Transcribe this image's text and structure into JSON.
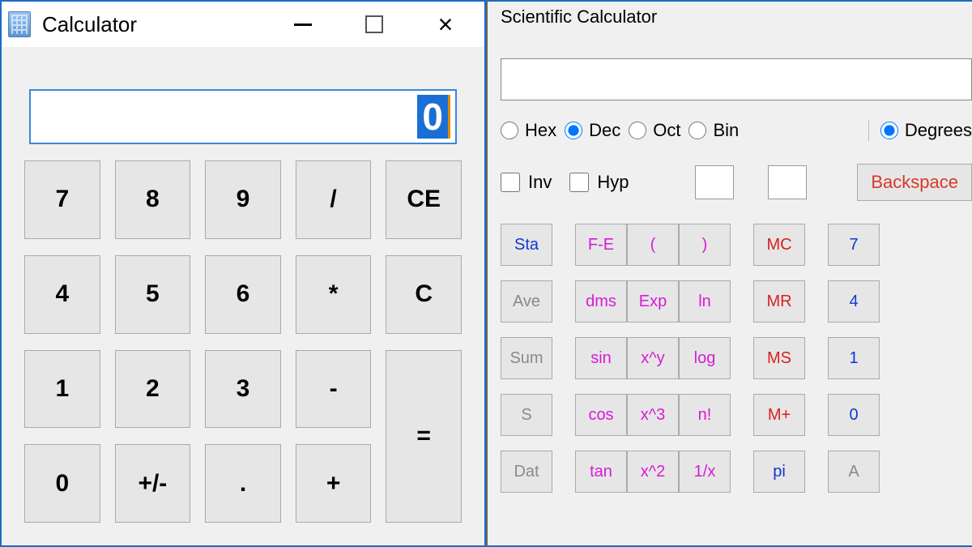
{
  "simple": {
    "title": "Calculator",
    "display": "0",
    "keys": [
      "7",
      "8",
      "9",
      "/",
      "CE",
      "4",
      "5",
      "6",
      "*",
      "C",
      "1",
      "2",
      "3",
      "-",
      "=",
      "0",
      "+/-",
      ".",
      "+"
    ]
  },
  "sci": {
    "title": "Scientific Calculator",
    "display": "",
    "bases": [
      {
        "label": "Hex",
        "checked": false
      },
      {
        "label": "Dec",
        "checked": true
      },
      {
        "label": "Oct",
        "checked": false
      },
      {
        "label": "Bin",
        "checked": false
      }
    ],
    "angle": [
      {
        "label": "Degrees",
        "checked": true
      }
    ],
    "checks": [
      {
        "label": "Inv"
      },
      {
        "label": "Hyp"
      }
    ],
    "backspace": "Backspace",
    "rows": [
      {
        "stat": {
          "t": "Sta",
          "c": "blue"
        },
        "f": [
          {
            "t": "F-E",
            "c": "mag"
          },
          {
            "t": "(",
            "c": "mag"
          },
          {
            "t": ")",
            "c": "mag"
          }
        ],
        "mem": {
          "t": "MC",
          "c": "red"
        },
        "num": {
          "t": "7",
          "c": "blue"
        }
      },
      {
        "stat": {
          "t": "Ave",
          "c": "gray"
        },
        "f": [
          {
            "t": "dms",
            "c": "mag"
          },
          {
            "t": "Exp",
            "c": "mag"
          },
          {
            "t": "ln",
            "c": "mag"
          }
        ],
        "mem": {
          "t": "MR",
          "c": "red"
        },
        "num": {
          "t": "4",
          "c": "blue"
        }
      },
      {
        "stat": {
          "t": "Sum",
          "c": "gray"
        },
        "f": [
          {
            "t": "sin",
            "c": "mag"
          },
          {
            "t": "x^y",
            "c": "mag"
          },
          {
            "t": "log",
            "c": "mag"
          }
        ],
        "mem": {
          "t": "MS",
          "c": "red"
        },
        "num": {
          "t": "1",
          "c": "blue"
        }
      },
      {
        "stat": {
          "t": "S",
          "c": "gray"
        },
        "f": [
          {
            "t": "cos",
            "c": "mag"
          },
          {
            "t": "x^3",
            "c": "mag"
          },
          {
            "t": "n!",
            "c": "mag"
          }
        ],
        "mem": {
          "t": "M+",
          "c": "red"
        },
        "num": {
          "t": "0",
          "c": "blue"
        }
      },
      {
        "stat": {
          "t": "Dat",
          "c": "gray"
        },
        "f": [
          {
            "t": "tan",
            "c": "mag"
          },
          {
            "t": "x^2",
            "c": "mag"
          },
          {
            "t": "1/x",
            "c": "mag"
          }
        ],
        "mem": {
          "t": "pi",
          "c": "blue"
        },
        "num": {
          "t": "A",
          "c": "gray"
        }
      }
    ]
  }
}
